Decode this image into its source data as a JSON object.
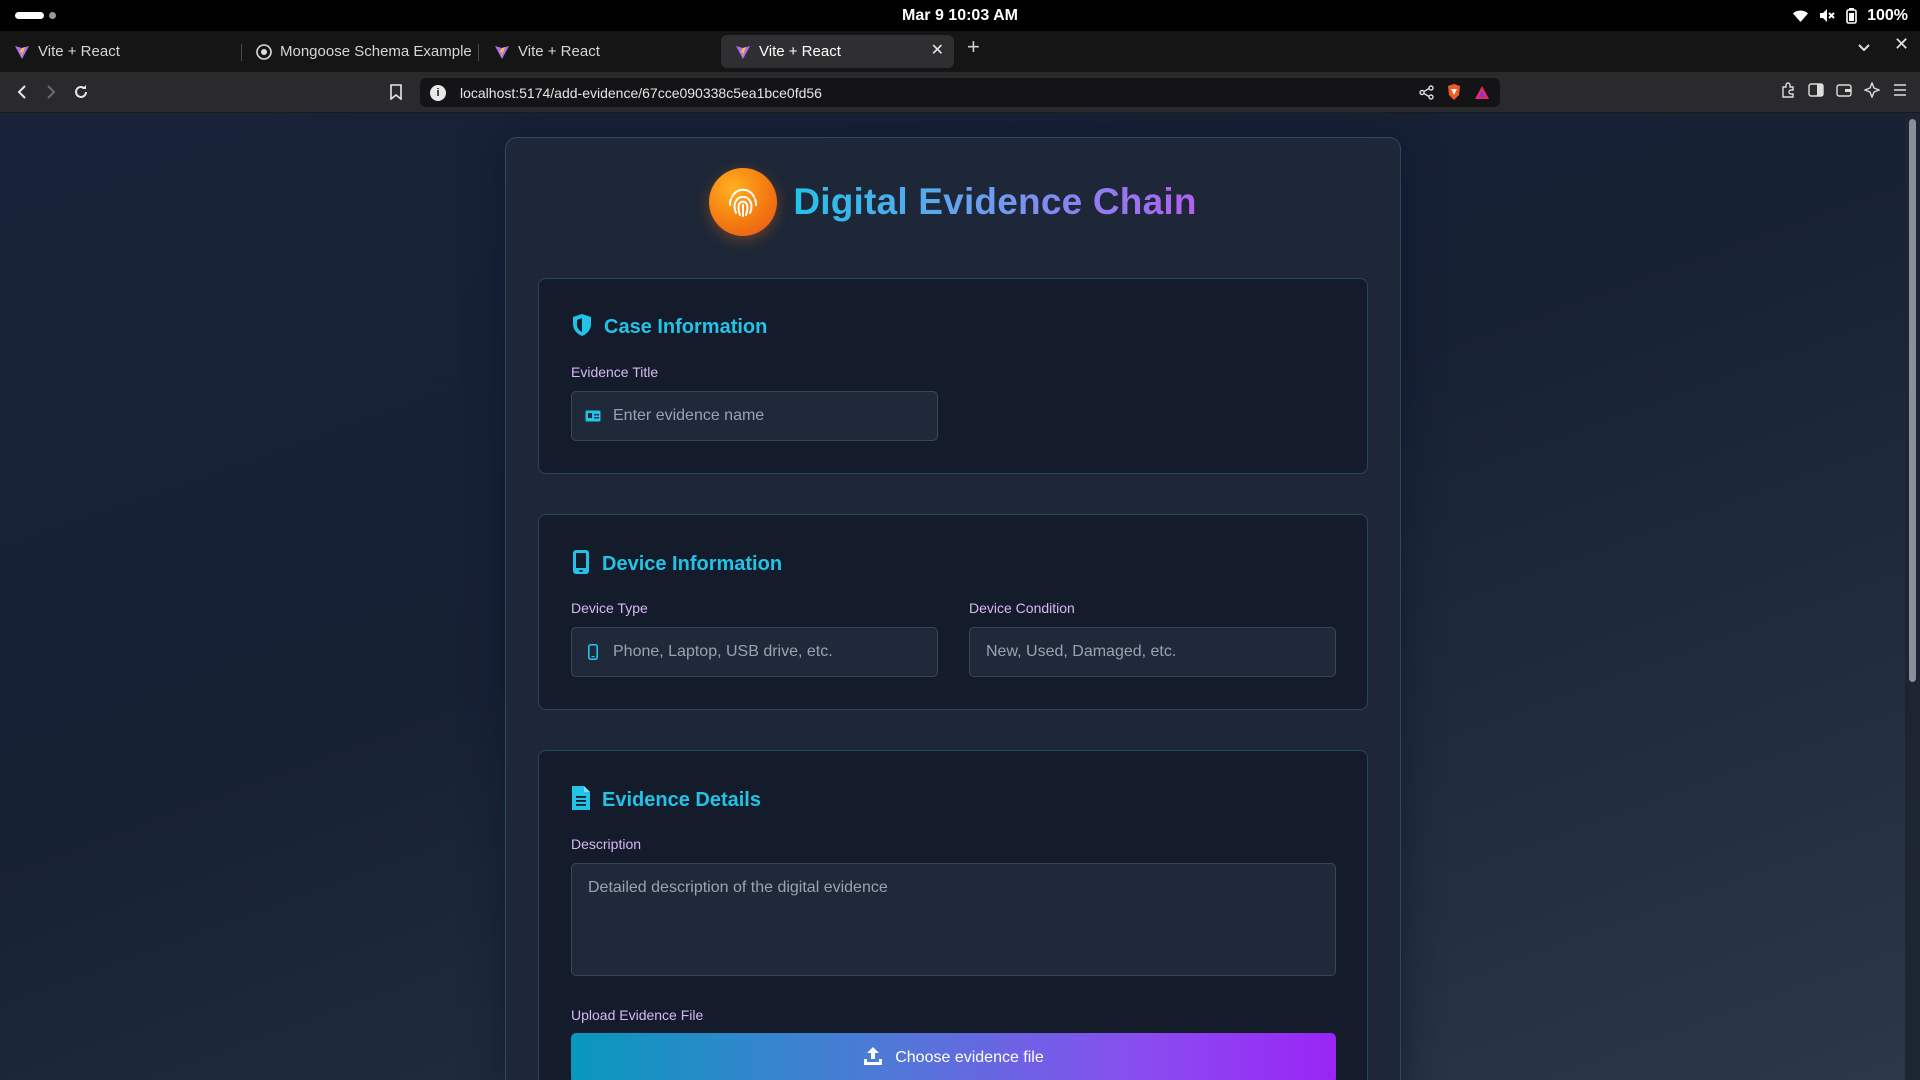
{
  "system": {
    "datetime": "Mar 9  10:03 AM",
    "battery": "100%"
  },
  "tabs": [
    {
      "label": "Vite + React",
      "active": false
    },
    {
      "label": "Mongoose Schema Example",
      "active": false
    },
    {
      "label": "Vite + React",
      "active": false
    },
    {
      "label": "Vite + React",
      "active": true
    }
  ],
  "browser": {
    "url": "localhost:5174/add-evidence/67cce090338c5ea1bce0fd56"
  },
  "app": {
    "title": "Digital Evidence Chain",
    "logo_icon": "fingerprint-icon",
    "accent_color": "#22c3e6",
    "label_color": "#d8b8f4"
  },
  "sections": {
    "case": {
      "heading": "Case Information",
      "icon": "shield-icon",
      "evidence_title_label": "Evidence Title",
      "evidence_title_placeholder": "Enter evidence name"
    },
    "device": {
      "heading": "Device Information",
      "icon": "phone-icon",
      "device_type_label": "Device Type",
      "device_type_placeholder": "Phone, Laptop, USB drive, etc.",
      "device_condition_label": "Device Condition",
      "device_condition_placeholder": "New, Used, Damaged, etc."
    },
    "details": {
      "heading": "Evidence Details",
      "icon": "document-icon",
      "description_label": "Description",
      "description_placeholder": "Detailed description of the digital evidence",
      "upload_label": "Upload Evidence File",
      "upload_button": "Choose evidence file"
    }
  }
}
